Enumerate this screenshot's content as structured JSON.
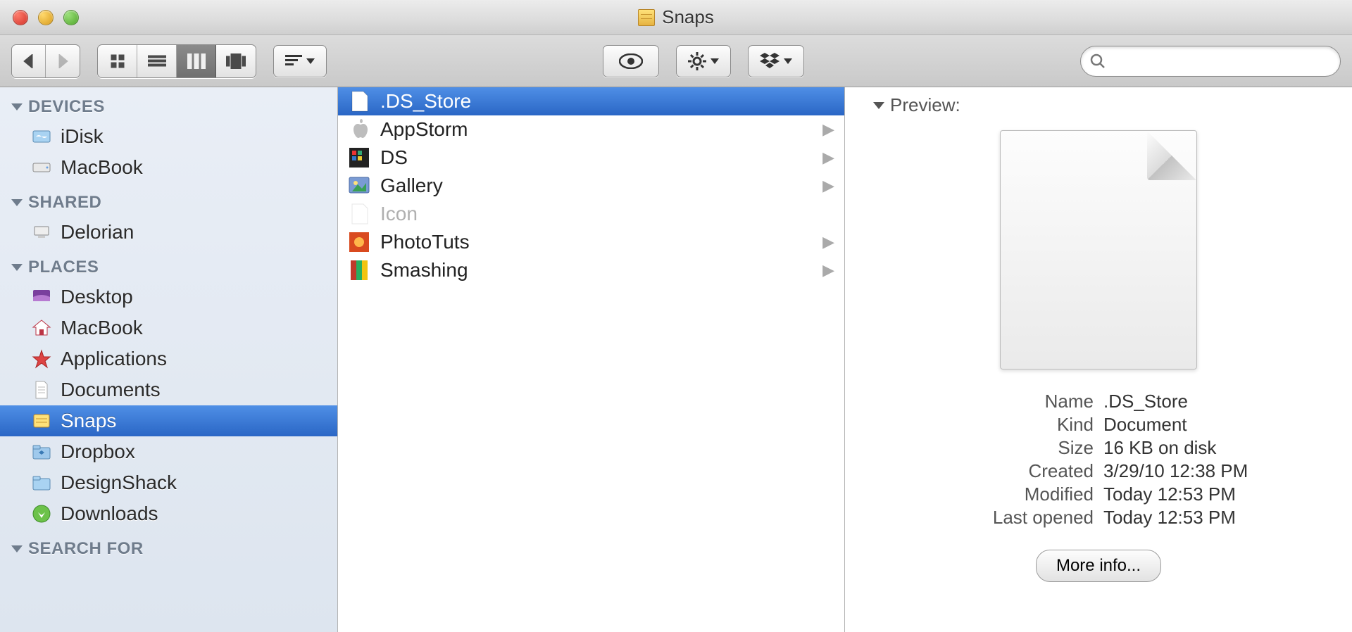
{
  "window": {
    "title": "Snaps"
  },
  "search": {
    "placeholder": ""
  },
  "sidebar": {
    "sections": [
      {
        "heading": "DEVICES",
        "items": [
          {
            "label": "iDisk",
            "icon": "idisk"
          },
          {
            "label": "MacBook",
            "icon": "hdd"
          }
        ]
      },
      {
        "heading": "SHARED",
        "items": [
          {
            "label": "Delorian",
            "icon": "network-pc"
          }
        ]
      },
      {
        "heading": "PLACES",
        "items": [
          {
            "label": "Desktop",
            "icon": "desktop"
          },
          {
            "label": "MacBook",
            "icon": "home"
          },
          {
            "label": "Applications",
            "icon": "applications"
          },
          {
            "label": "Documents",
            "icon": "documents"
          },
          {
            "label": "Snaps",
            "icon": "notes",
            "selected": true
          },
          {
            "label": "Dropbox",
            "icon": "dropbox"
          },
          {
            "label": "DesignShack",
            "icon": "folder"
          },
          {
            "label": "Downloads",
            "icon": "downloads"
          }
        ]
      },
      {
        "heading": "SEARCH FOR",
        "items": []
      }
    ]
  },
  "column_items": [
    {
      "label": ".DS_Store",
      "icon": "blank-doc",
      "folder": false,
      "selected": true
    },
    {
      "label": "AppStorm",
      "icon": "apple",
      "folder": true
    },
    {
      "label": "DS",
      "icon": "ds",
      "folder": true
    },
    {
      "label": "Gallery",
      "icon": "gallery",
      "folder": true
    },
    {
      "label": "Icon",
      "icon": "blank-doc-dim",
      "folder": false,
      "dimmed": true
    },
    {
      "label": "PhotoTuts",
      "icon": "phototuts",
      "folder": true
    },
    {
      "label": "Smashing",
      "icon": "smashing",
      "folder": true
    }
  ],
  "preview": {
    "heading": "Preview:",
    "meta": {
      "name_label": "Name",
      "name_value": ".DS_Store",
      "kind_label": "Kind",
      "kind_value": "Document",
      "size_label": "Size",
      "size_value": "16 KB on disk",
      "created_label": "Created",
      "created_value": "3/29/10 12:38 PM",
      "modified_label": "Modified",
      "modified_value": "Today 12:53 PM",
      "lastopened_label": "Last opened",
      "lastopened_value": "Today 12:53 PM"
    },
    "more_info_label": "More info..."
  }
}
